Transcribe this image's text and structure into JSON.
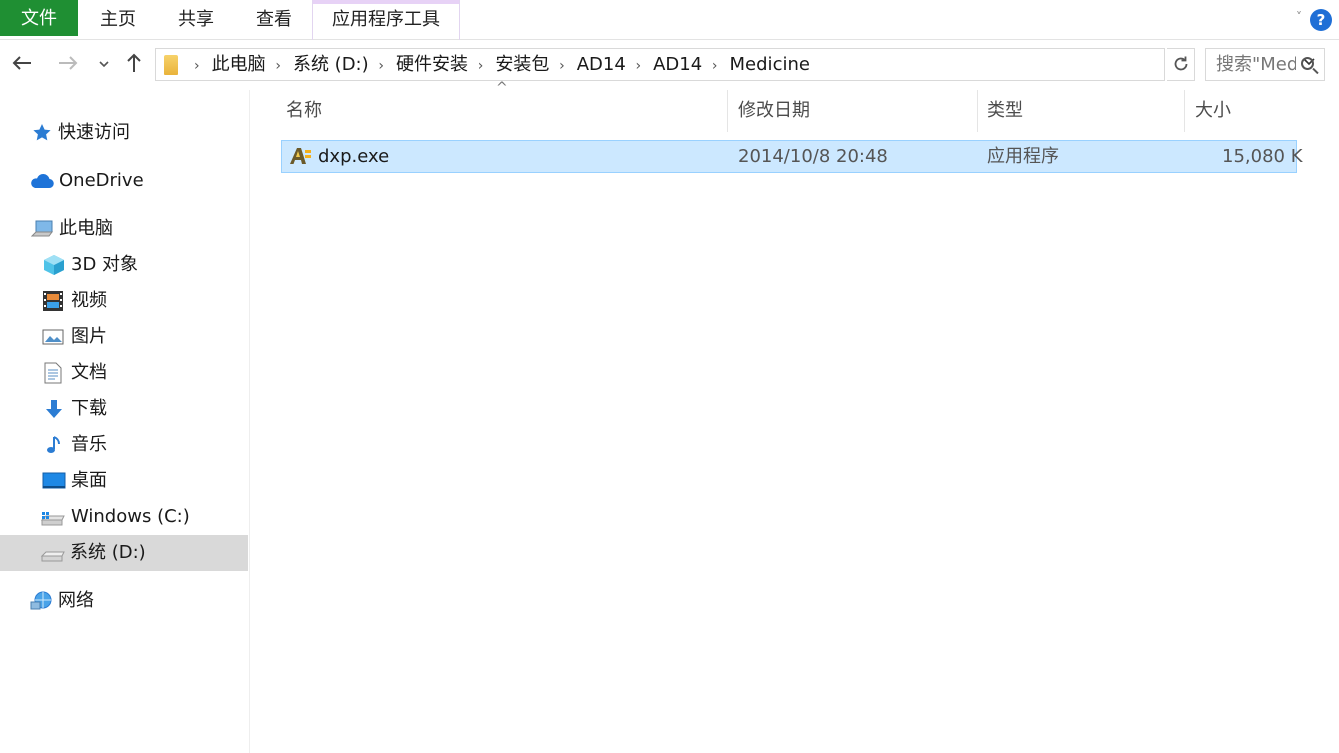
{
  "ribbon": {
    "tabs": [
      "文件",
      "主页",
      "共享",
      "查看",
      "应用程序工具"
    ],
    "help_label": "?"
  },
  "nav": {
    "breadcrumb": [
      "此电脑",
      "系统 (D:)",
      "硬件安装",
      "安装包",
      "AD14",
      "AD14",
      "Medicine"
    ],
    "search_placeholder": "搜索\"Medicine\""
  },
  "sidebar": {
    "items": [
      {
        "label": "快速访问",
        "icon": "star-icon"
      },
      {
        "label": "OneDrive",
        "icon": "cloud-icon"
      },
      {
        "label": "此电脑",
        "icon": "computer-icon"
      },
      {
        "label": "3D 对象",
        "icon": "cube-icon"
      },
      {
        "label": "视频",
        "icon": "film-icon"
      },
      {
        "label": "图片",
        "icon": "picture-icon"
      },
      {
        "label": "文档",
        "icon": "document-icon"
      },
      {
        "label": "下载",
        "icon": "download-icon"
      },
      {
        "label": "音乐",
        "icon": "music-icon"
      },
      {
        "label": "桌面",
        "icon": "desktop-icon"
      },
      {
        "label": "Windows (C:)",
        "icon": "drive-c-icon"
      },
      {
        "label": "系统 (D:)",
        "icon": "drive-d-icon",
        "selected": true
      },
      {
        "label": "网络",
        "icon": "network-icon"
      }
    ]
  },
  "table": {
    "columns": [
      "名称",
      "修改日期",
      "类型",
      "大小"
    ],
    "rows": [
      {
        "name": "dxp.exe",
        "date": "2014/10/8 20:48",
        "type": "应用程序",
        "size": "15,080 K"
      }
    ]
  },
  "colors": {
    "file_tab": "#1f8f33",
    "selection": "#cce8ff",
    "selection_border": "#99d1ff",
    "sidebar_selected": "#d9d9d9"
  }
}
